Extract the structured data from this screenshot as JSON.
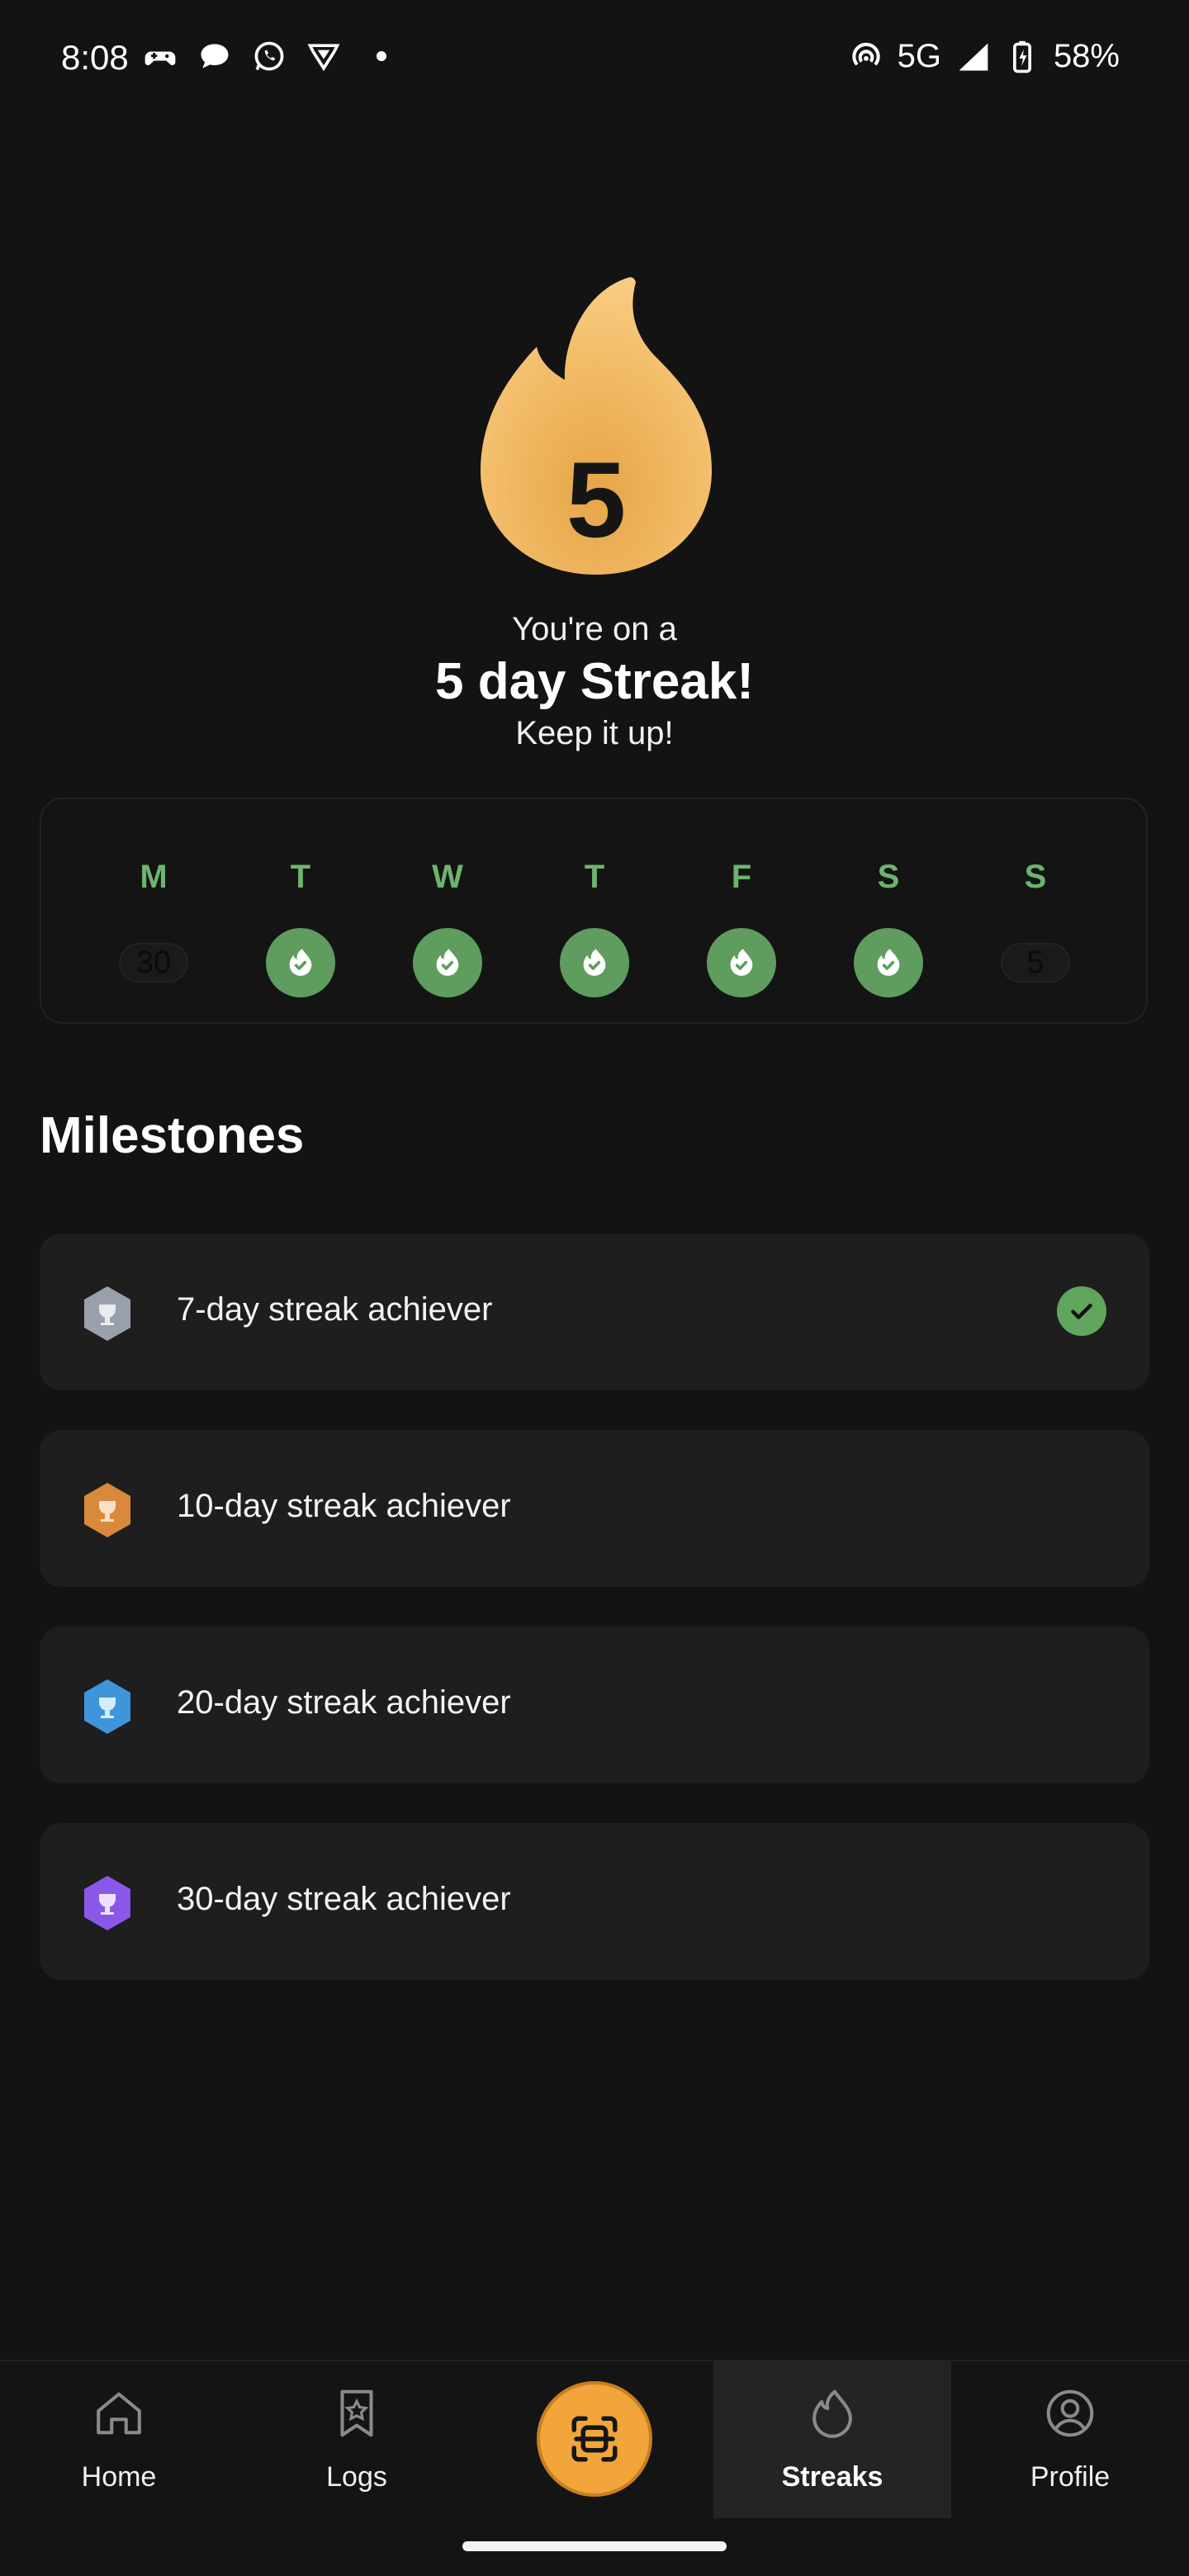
{
  "status_bar": {
    "time": "8:08",
    "network": "5G",
    "battery": "58%"
  },
  "streak": {
    "count": "5",
    "pre_text": "You're on a",
    "title": "5 day Streak!",
    "post_text": "Keep it up!"
  },
  "week": {
    "days": [
      {
        "letter": "M",
        "value": "30",
        "state": "inactive"
      },
      {
        "letter": "T",
        "state": "done"
      },
      {
        "letter": "W",
        "state": "done"
      },
      {
        "letter": "T",
        "state": "done"
      },
      {
        "letter": "F",
        "state": "done"
      },
      {
        "letter": "S",
        "state": "done"
      },
      {
        "letter": "S",
        "value": "5",
        "state": "inactive"
      }
    ]
  },
  "milestones": {
    "title": "Milestones",
    "items": [
      {
        "label": "7-day streak achiever",
        "color": "#9aa0ab",
        "completed": true
      },
      {
        "label": "10-day streak achiever",
        "color": "#d9893c",
        "completed": false
      },
      {
        "label": "20-day streak achiever",
        "color": "#3e95da",
        "completed": false
      },
      {
        "label": "30-day streak achiever",
        "color": "#8a57e8",
        "completed": false
      }
    ]
  },
  "nav": {
    "home": "Home",
    "logs": "Logs",
    "streaks": "Streaks",
    "profile": "Profile",
    "active": "streaks"
  },
  "colors": {
    "accent": "#f2a53a",
    "success": "#5e9d5d",
    "background": "#131313"
  }
}
